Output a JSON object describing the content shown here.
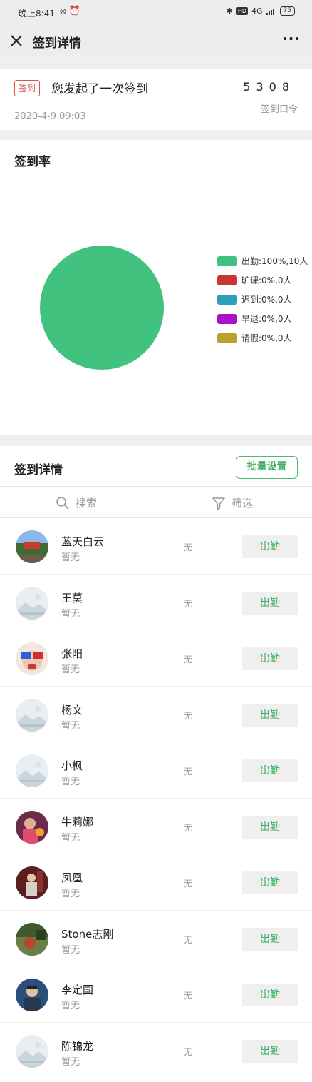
{
  "status_bar": {
    "time": "晚上8:41",
    "network": "4G",
    "battery": "75"
  },
  "nav": {
    "title": "签到详情",
    "more": "···"
  },
  "info": {
    "tag": "签到",
    "text": "您发起了一次签到",
    "code": "5308",
    "date": "2020-4-9 09:03",
    "code_label": "签到口令"
  },
  "rate": {
    "title": "签到率",
    "legend": [
      {
        "label": "出勤:100%,10人",
        "color": "#42c27f"
      },
      {
        "label": "旷课:0%,0人",
        "color": "#c8362f"
      },
      {
        "label": "迟到:0%,0人",
        "color": "#2e9fb8"
      },
      {
        "label": "早退:0%,0人",
        "color": "#a812c9"
      },
      {
        "label": "请假:0%,0人",
        "color": "#b8a22c"
      }
    ]
  },
  "chart_data": {
    "type": "pie",
    "categories": [
      "出勤",
      "旷课",
      "迟到",
      "早退",
      "请假"
    ],
    "values": [
      10,
      0,
      0,
      0,
      0
    ],
    "colors": [
      "#42c27f",
      "#c8362f",
      "#2e9fb8",
      "#a812c9",
      "#b8a22c"
    ],
    "title": "签到率",
    "legend_position": "right"
  },
  "detail": {
    "title": "签到详情",
    "batch_button": "批量设置",
    "search_label": "搜索",
    "filter_label": "筛选",
    "rows": [
      {
        "name": "蓝天白云",
        "note": "暂无",
        "remark": "无",
        "status": "出勤",
        "avatar": "photo-park"
      },
      {
        "name": "王莫",
        "note": "暂无",
        "remark": "无",
        "status": "出勤",
        "avatar": "default"
      },
      {
        "name": "张阳",
        "note": "暂无",
        "remark": "无",
        "status": "出勤",
        "avatar": "photo-3dglasses"
      },
      {
        "name": "杨文",
        "note": "暂无",
        "remark": "无",
        "status": "出勤",
        "avatar": "default"
      },
      {
        "name": "小枫",
        "note": "暂无",
        "remark": "无",
        "status": "出勤",
        "avatar": "default"
      },
      {
        "name": "牛莉娜",
        "note": "暂无",
        "remark": "无",
        "status": "出勤",
        "avatar": "photo-people"
      },
      {
        "name": "凤凰",
        "note": "暂无",
        "remark": "无",
        "status": "出勤",
        "avatar": "photo-stage"
      },
      {
        "name": "Stone志刚",
        "note": "暂无",
        "remark": "无",
        "status": "出勤",
        "avatar": "photo-garden"
      },
      {
        "name": "李定国",
        "note": "暂无",
        "remark": "无",
        "status": "出勤",
        "avatar": "photo-portrait"
      },
      {
        "name": "陈锦龙",
        "note": "暂无",
        "remark": "无",
        "status": "出勤",
        "avatar": "default"
      }
    ]
  }
}
